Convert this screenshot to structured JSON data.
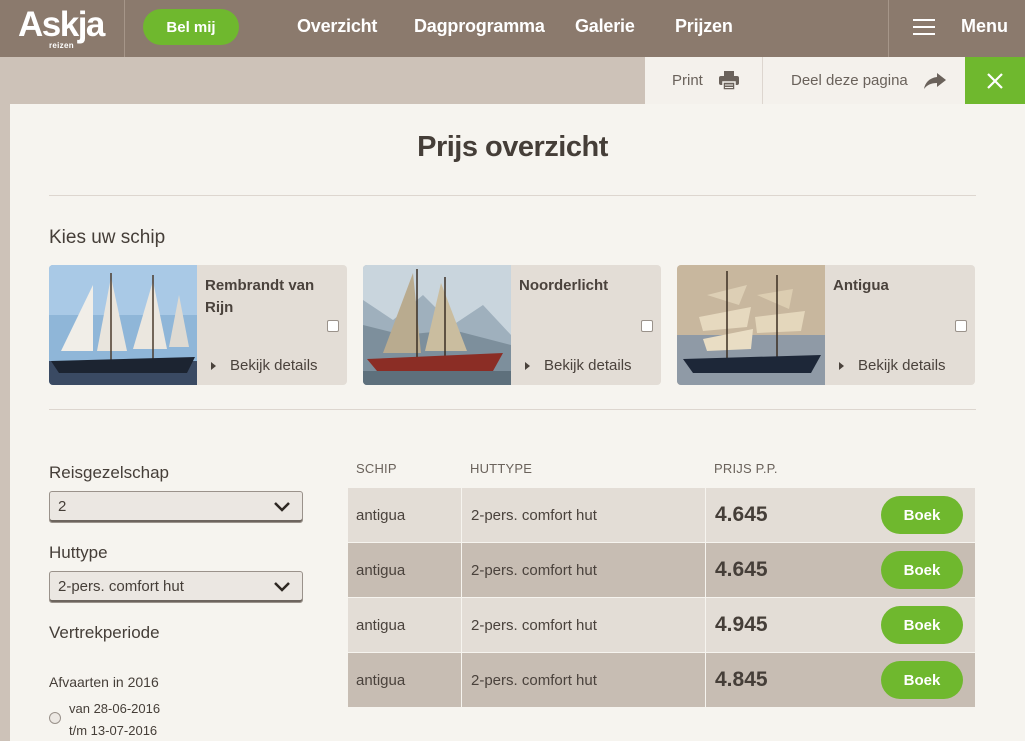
{
  "header": {
    "logo_text": "Askja",
    "logo_sub": "reizen",
    "call_button": "Bel mij",
    "nav": [
      "Overzicht",
      "Dagprogramma",
      "Galerie",
      "Prijzen"
    ],
    "menu_label": "Menu"
  },
  "actions": {
    "print": "Print",
    "share": "Deel deze pagina"
  },
  "page": {
    "title": "Prijs overzicht",
    "ships_heading": "Kies uw schip",
    "ships": [
      {
        "name": "Rembrandt van Rijn",
        "details": "Bekijk details"
      },
      {
        "name": "Noorderlicht",
        "details": "Bekijk details"
      },
      {
        "name": "Antigua",
        "details": "Bekijk details"
      }
    ]
  },
  "filters": {
    "group_label": "Reisgezelschap",
    "group_value": "2",
    "cabin_label": "Huttype",
    "cabin_value": "2-pers. comfort hut",
    "period_label": "Vertrekperiode",
    "sailings_label": "Afvaarten in 2016",
    "sailing_1_from": "van 28-06-2016",
    "sailing_1_to": "t/m 13-07-2016"
  },
  "table": {
    "headers": [
      "SCHIP",
      "HUTTYPE",
      "PRIJS P.P."
    ],
    "book_label": "Boek",
    "rows": [
      {
        "ship": "antigua",
        "cabin": "2-pers. comfort hut",
        "price": "4.645"
      },
      {
        "ship": "antigua",
        "cabin": "2-pers. comfort hut",
        "price": "4.645"
      },
      {
        "ship": "antigua",
        "cabin": "2-pers. comfort hut",
        "price": "4.945"
      },
      {
        "ship": "antigua",
        "cabin": "2-pers. comfort hut",
        "price": "4.845"
      }
    ]
  },
  "colors": {
    "header_bg": "#8b7a6d",
    "accent_green": "#6fb82e",
    "panel_bg": "#f6f4ef",
    "row_light": "#e3ddd6",
    "row_dark": "#c7bdb3"
  }
}
